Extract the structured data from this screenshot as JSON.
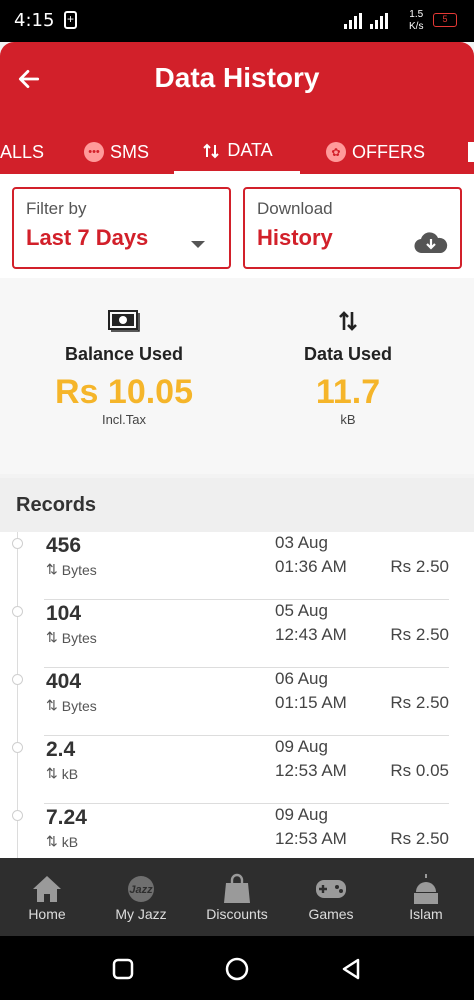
{
  "status_bar": {
    "time": "4:15",
    "network_speed": "1.5\nK/s",
    "battery": "5"
  },
  "header": {
    "title": "Data History",
    "back_icon": "back-arrow-icon"
  },
  "tabs": [
    {
      "label": "ALLS",
      "icon": ""
    },
    {
      "label": "SMS",
      "icon": "chat-bubble-icon"
    },
    {
      "label": "DATA",
      "icon": "up-down-arrows-icon",
      "active": true
    },
    {
      "label": "OFFERS",
      "icon": "offers-icon"
    }
  ],
  "filter": {
    "filter_label": "Filter by",
    "filter_value": "Last 7 Days",
    "download_label": "Download",
    "download_value": "History"
  },
  "summary": {
    "balance_label": "Balance Used",
    "balance_value": "Rs 10.05",
    "balance_sub": "Incl.Tax",
    "data_label": "Data Used",
    "data_value": "11.7",
    "data_sub": "kB"
  },
  "records": {
    "title": "Records",
    "rows": [
      {
        "amount": "456",
        "unit": "Bytes",
        "date": "03 Aug",
        "time": "01:36 AM",
        "cost": "Rs 2.50"
      },
      {
        "amount": "104",
        "unit": "Bytes",
        "date": "05 Aug",
        "time": "12:43 AM",
        "cost": "Rs 2.50"
      },
      {
        "amount": "404",
        "unit": "Bytes",
        "date": "06 Aug",
        "time": "01:15 AM",
        "cost": "Rs 2.50"
      },
      {
        "amount": "2.4",
        "unit": "kB",
        "date": "09 Aug",
        "time": "12:53 AM",
        "cost": "Rs 0.05"
      },
      {
        "amount": "7.24",
        "unit": "kB",
        "date": "09 Aug",
        "time": "12:53 AM",
        "cost": "Rs 2.50"
      }
    ]
  },
  "bottom_nav": [
    {
      "label": "Home",
      "icon": "home-icon"
    },
    {
      "label": "My Jazz",
      "icon": "jazz-logo-icon"
    },
    {
      "label": "Discounts",
      "icon": "shopping-bag-icon"
    },
    {
      "label": "Games",
      "icon": "gamepad-icon"
    },
    {
      "label": "Islam",
      "icon": "mosque-icon"
    }
  ],
  "colors": {
    "brand_red": "#d2202a",
    "accent_yellow": "#f5b52a",
    "nav_dark": "#2e2e2e"
  }
}
